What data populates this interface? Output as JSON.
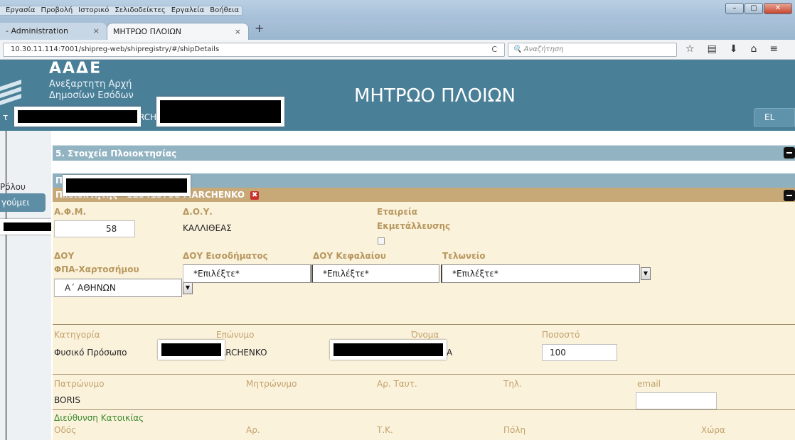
{
  "browser": {
    "menu": [
      "Εργασία",
      "Προβολή",
      "Ιστορικό",
      "Σελιδοδείκτες",
      "Εργαλεία",
      "Βοήθεια"
    ],
    "tabs": [
      {
        "label": "- Administration",
        "close": "×"
      },
      {
        "label": "ΜΗΤΡΩΟ ΠΛΟΙΩΝ",
        "close": "×"
      }
    ],
    "new_tab": "+",
    "url": "10.30.11.114:7001/shipreg-web/shipregistry/#/shipDetails",
    "reload": "C",
    "search_placeholder": "Αναζήτηση",
    "window_controls": {
      "minimize": "–",
      "maximize": "▢",
      "close": "✕"
    }
  },
  "header": {
    "org_abbr": "ΑΑΔΕ",
    "org_line1": "Ανεξαρτητη Αρχή",
    "org_line2": "Δημοσίων Εσόδων",
    "app_title": "ΜΗΤΡΩΟ ΠΛΟΙΩΝ",
    "user_prefix": "τ",
    "user_tail": "RCHEN",
    "language": "EL"
  },
  "left": {
    "link1": "Ρόλου",
    "link2": "γούμει"
  },
  "section": {
    "title": "5. Στοιχεία Πλοιοκτησίας",
    "sub_prefix": "Π",
    "owner_title": "Πλοιοκτήτης - 123415758 MARCHENKO",
    "owner_close": "✖"
  },
  "owner": {
    "afm_label": "Α.Φ.Μ.",
    "afm_value": "58",
    "doy_label": "Δ.Ο.Υ.",
    "doy_value": "ΚΑΛΛΙΘΕΑΣ",
    "company_label1": "Εταιρεία",
    "company_label2": "Εκμετάλλευσης",
    "vat_label1": "ΔΟΥ",
    "vat_label2": "ΦΠΑ-Χαρτοσήμου",
    "vat_value": "Α΄ ΑΘΗΝΩΝ",
    "income_label": "ΔΟΥ Εισοδήματος",
    "income_value": "*Επιλέξτε*",
    "capital_label": "ΔΟΥ Κεφαλαίου",
    "capital_value": "*Επιλέξτε*",
    "customs_label": "Τελωνείο",
    "customs_value": "*Επιλέξτε*",
    "category_label": "Κατηγορία",
    "category_value": "Φυσικό Πρόσωπο",
    "surname_label": "Επώνυμο",
    "surname_value": "ARCHENKO",
    "name_label": "Όνομα",
    "name_value": "A",
    "percent_label": "Ποσοστό",
    "percent_value": "100",
    "father_label": "Πατρώνυμο",
    "father_value": "BORIS",
    "mother_label": "Μητρώνυμο",
    "id_label": "Αρ. Ταυτ.",
    "phone_label": "Τηλ.",
    "email_label": "email",
    "address_section": "Διεύθυνση Κατοικίας",
    "street_label": "Οδός",
    "number_label": "Αρ.",
    "zip_label": "Τ.Κ.",
    "city_label": "Πόλη",
    "country_label": "Χώρα"
  },
  "colors": {
    "header": "#4a7f98",
    "section_bar": "#92b3c2",
    "owner_bar": "#c7a877",
    "owner_panel": "#fbf2dc",
    "label": "#b7975e",
    "address_label": "#3c8a2e"
  }
}
